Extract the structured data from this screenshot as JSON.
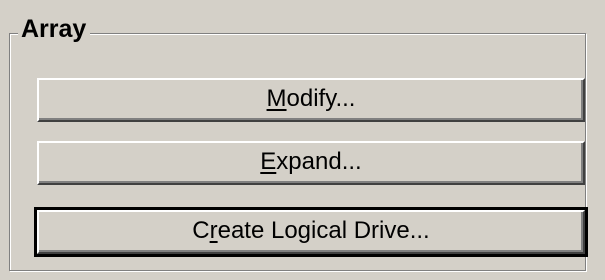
{
  "group": {
    "title": "Array"
  },
  "buttons": {
    "modify": {
      "pre": "",
      "mnemonic": "M",
      "post": "odify..."
    },
    "expand": {
      "pre": "",
      "mnemonic": "E",
      "post": "xpand..."
    },
    "create": {
      "pre": "C",
      "mnemonic": "r",
      "post": "eate Logical Drive..."
    }
  },
  "colors": {
    "face": "#d4d0c8",
    "highlight": "#ffffff",
    "shadow": "#808080",
    "dark_shadow": "#404040",
    "text": "#000000"
  }
}
